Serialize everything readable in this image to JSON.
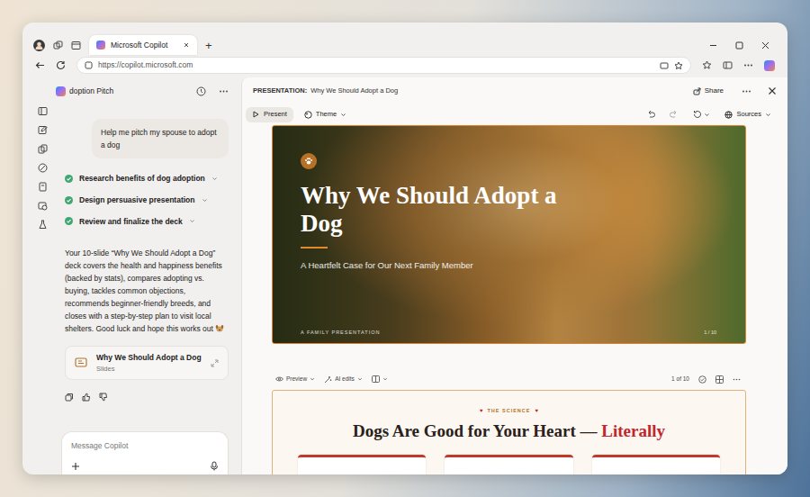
{
  "browser": {
    "tabs": [
      {
        "label": "Microsoft Copilot",
        "selected": true
      }
    ],
    "new_tab": "+",
    "url": "https://copilot.microsoft.com"
  },
  "chat": {
    "title": "doption Pitch",
    "user_message": "Help me pitch my spouse to adopt a dog",
    "steps": [
      {
        "label": "Research benefits of dog adoption",
        "done": true
      },
      {
        "label": "Design persuasive presentation",
        "done": true
      },
      {
        "label": "Review and finalize the deck",
        "done": true
      }
    ],
    "response": "Your 10-slide “Why We Should Adopt a Dog” deck covers the health and happiness benefits (backed by stats), compares adopting vs. buying, tackles common objections, recommends beginner-friendly breeds, and closes with a step-by-step plan to visit local shelters. Good luck and hope this works out",
    "attachment": {
      "title": "Why We Should Adopt a Dog",
      "subtitle": "Slides"
    },
    "input_placeholder": "Message Copilot"
  },
  "presentation": {
    "label": "PRESENTATION:",
    "title": "Why We Should Adopt a Dog",
    "share": "Share",
    "present": "Present",
    "theme": "Theme",
    "sources": "Sources",
    "slide1": {
      "title": "Why We Should Adopt a Dog",
      "subtitle": "A Heartfelt Case for Our Next Family Member",
      "footer": "A FAMILY PRESENTATION",
      "page": "1 / 10"
    },
    "slide_toolbar": {
      "preview": "Preview",
      "ai_edits": "AI edits",
      "counter": "1 of 10"
    },
    "slide2": {
      "kicker_icon": "♥",
      "kicker": "THE SCIENCE",
      "heading": "Dogs Are Good for Your Heart —",
      "emphasis": "Literally"
    }
  }
}
